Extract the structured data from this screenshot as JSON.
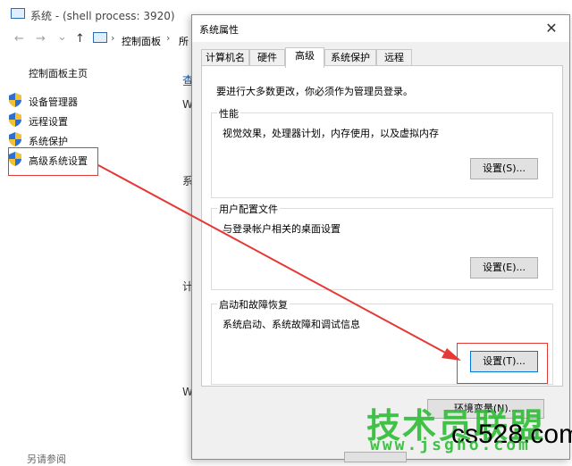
{
  "bg_window": {
    "title": "系统 - (shell process: 3920)",
    "nav": {
      "back": "←",
      "forward": "→",
      "dropdown": "⌄",
      "up": "↑"
    },
    "breadcrumb": [
      "控制面板",
      "所"
    ],
    "breadcrumb_sep": "›",
    "left_home": "控制面板主页",
    "left_items": [
      "设备管理器",
      "远程设置",
      "系统保护",
      "高级系统设置"
    ],
    "peek_text": [
      "查",
      "W",
      "系",
      "计",
      "W"
    ],
    "bottom_left": "另请参阅"
  },
  "dialog": {
    "title": "系统属性",
    "close": "✕",
    "tabs": [
      "计算机名",
      "硬件",
      "高级",
      "系统保护",
      "远程"
    ],
    "active_tab": "高级",
    "admin_note": "要进行大多数更改，你必须作为管理员登录。",
    "groups": [
      {
        "legend": "性能",
        "description": "视觉效果，处理器计划，内存使用，以及虚拟内存",
        "button": "设置(S)..."
      },
      {
        "legend": "用户配置文件",
        "description": "与登录帐户相关的桌面设置",
        "button": "设置(E)..."
      },
      {
        "legend": "启动和故障恢复",
        "description": "系统启动、系统故障和调试信息",
        "button": "设置(T)..."
      }
    ],
    "env_button": "环境变量(N)..."
  },
  "watermark": {
    "line1": "技术员联盟",
    "line2": "www.jsgho.com",
    "site": "cs528.com"
  },
  "colors": {
    "annotation_red": "#e53935",
    "watermark_green": "#2fbd36",
    "accent_blue": "#0078d7"
  }
}
